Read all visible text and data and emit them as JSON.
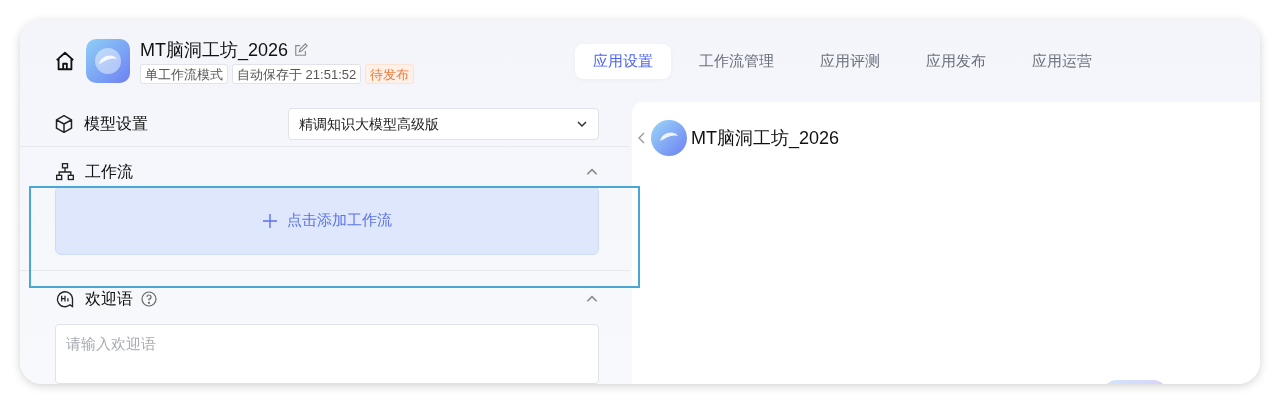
{
  "header": {
    "app_name": "MT脑洞工坊_2026",
    "tags": [
      {
        "text": "单工作流模式",
        "kind": "plain"
      },
      {
        "text": "自动保存于 21:51:52",
        "kind": "plain"
      },
      {
        "text": "待发布",
        "kind": "warning"
      }
    ]
  },
  "tabs": [
    {
      "label": "应用设置",
      "selected": true
    },
    {
      "label": "工作流管理",
      "selected": false
    },
    {
      "label": "应用评测",
      "selected": false
    },
    {
      "label": "应用发布",
      "selected": false
    },
    {
      "label": "应用运营",
      "selected": false
    }
  ],
  "model_settings": {
    "title": "模型设置",
    "selected_model": "精调知识大模型高级版"
  },
  "workflow": {
    "title": "工作流",
    "expanded": true,
    "highlighted": true,
    "add_button": "点击添加工作流"
  },
  "greeting": {
    "title": "欢迎语",
    "expanded": true,
    "placeholder": "请输入欢迎语"
  },
  "preview": {
    "app_name": "MT脑洞工坊_2026"
  }
}
